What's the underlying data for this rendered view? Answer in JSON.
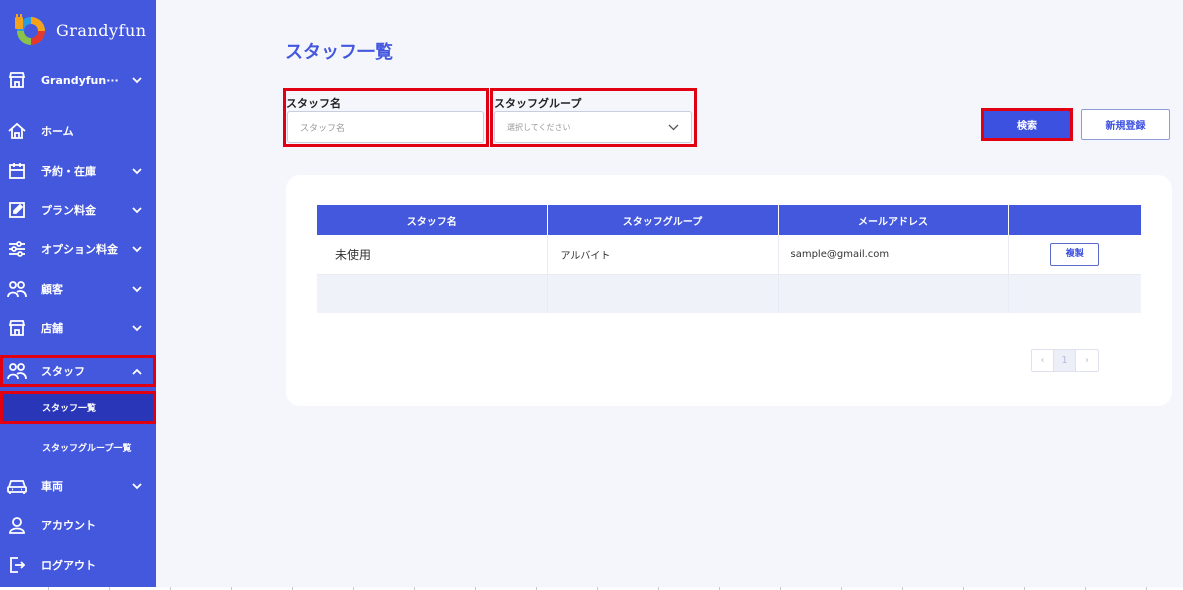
{
  "app": {
    "name": "Grandyfun",
    "accent": "#4458de",
    "highlight": "#e00012"
  },
  "sidebar": {
    "items": [
      {
        "label": "Grandyfun···",
        "icon": "store-icon",
        "expandable": true
      },
      {
        "label": "ホーム",
        "icon": "home-icon",
        "expandable": false
      },
      {
        "label": "予約・在庫",
        "icon": "calendar-icon",
        "expandable": true
      },
      {
        "label": "プラン料金",
        "icon": "edit-icon",
        "expandable": true
      },
      {
        "label": "オプション料金",
        "icon": "sliders-icon",
        "expandable": true
      },
      {
        "label": "顧客",
        "icon": "users-icon",
        "expandable": true
      },
      {
        "label": "店舗",
        "icon": "store-icon",
        "expandable": true
      },
      {
        "label": "スタッフ",
        "icon": "users-icon",
        "expandable": true,
        "expanded": true
      },
      {
        "label": "車両",
        "icon": "car-icon",
        "expandable": true
      },
      {
        "label": "アカウント",
        "icon": "user-icon",
        "expandable": false
      },
      {
        "label": "ログアウト",
        "icon": "logout-icon",
        "expandable": false
      }
    ],
    "subitems": [
      {
        "label": "スタッフ一覧",
        "active": true
      },
      {
        "label": "スタッフグループ一覧",
        "active": false
      }
    ]
  },
  "main": {
    "title": "スタッフ一覧",
    "filters": {
      "name_label": "スタッフ名",
      "name_placeholder": "スタッフ名",
      "group_label": "スタッフグループ",
      "group_placeholder": "選択してください"
    },
    "search_button": "検索",
    "new_button": "新規登録",
    "table": {
      "headers": [
        "スタッフ名",
        "スタッフグループ",
        "メールアドレス",
        ""
      ],
      "rows": [
        {
          "name": "未使用",
          "group": "アルバイト",
          "email": "sample@gmail.com",
          "action": "複製"
        }
      ]
    },
    "pagination": {
      "prev": "‹",
      "current": "1",
      "next": "›"
    }
  }
}
